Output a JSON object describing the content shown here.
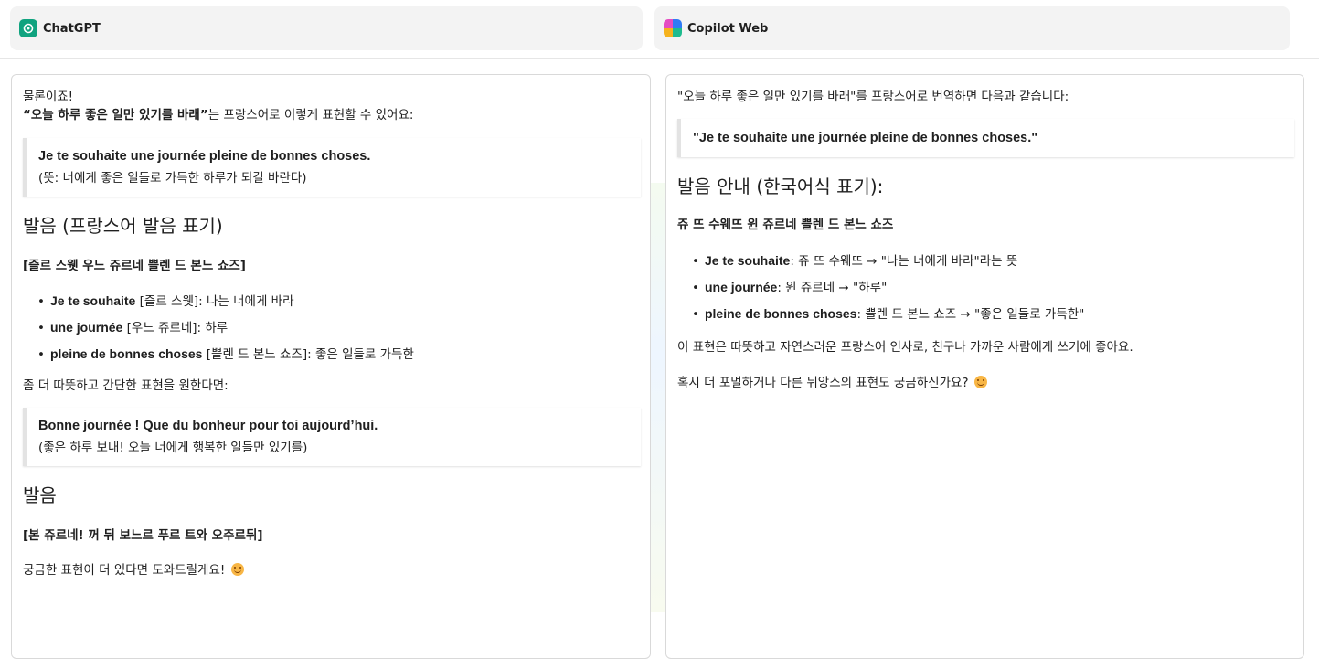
{
  "tabs": [
    {
      "label": "ChatGPT",
      "logo": "chatgpt-logo",
      "accent": "#10a37f"
    },
    {
      "label": "Copilot Web",
      "logo": "copilot-logo"
    }
  ],
  "left": {
    "greeting": "물론이죠!",
    "intro_bold": "“오늘 하루 좋은 일만 있기를 바래”",
    "intro_rest": "는 프랑스어로 이렇게 표현할 수 있어요:",
    "quote1_main": "Je te souhaite une journée pleine de bonnes choses.",
    "quote1_sub": "(뜻: 너에게 좋은 일들로 가득한 하루가 되길 바란다)",
    "heading1": "발음 (프랑스어 발음 표기)",
    "pron1": "[즐르 스웻 우느 쥬르네 쁠렌 드 본느 쇼즈]",
    "items": [
      {
        "fr": "Je te souhaite",
        "rest": " [즐르 스웻]: 나는 너에게 바라"
      },
      {
        "fr": "une journée",
        "rest": " [우느 쥬르네]: 하루"
      },
      {
        "fr": "pleine de bonnes choses",
        "rest": " [쁠렌 드 본느 쇼즈]: 좋은 일들로 가득한"
      }
    ],
    "para2": "좀 더 따뜻하고 간단한 표현을 원한다면:",
    "quote2_main": "Bonne journée ! Que du bonheur pour toi aujourd’hui.",
    "quote2_sub": "(좋은 하루 보내! 오늘 너에게 행복한 일들만 있기를)",
    "heading2": "발음",
    "pron2": "[본 쥬르네! 꺼 뒤 보느르 푸르 트와 오주르뒤]",
    "closing": "궁금한 표현이 더 있다면 도와드릴게요!"
  },
  "right": {
    "intro": "\"오늘 하루 좋은 일만 있기를 바래\"를 프랑스어로 번역하면 다음과 같습니다:",
    "quote": "\"Je te souhaite une journée pleine de bonnes choses.\"",
    "heading": "발음 안내 (한국어식 표기):",
    "pron": "쥬 뜨 수웨뜨 윈 쥬르네 쁠렌 드 본느 쇼즈",
    "items": [
      {
        "fr": "Je te souhaite",
        "rest": ": 쥬 뜨 수웨뜨 → \"나는 너에게 바라\"라는 뜻"
      },
      {
        "fr": "une journée",
        "rest": ": 윈 쥬르네 → \"하루\""
      },
      {
        "fr": "pleine de bonnes choses",
        "rest": ": 쁠렌 드 본느 쇼즈 → \"좋은 일들로 가득한\""
      }
    ],
    "para1": "이 표현은 따뜻하고 자연스러운 프랑스어 인사로, 친구나 가까운 사람에게 쓰기에 좋아요.",
    "para2": "혹시 더 포멀하거나 다른 뉘앙스의 표현도 궁금하신가요?"
  }
}
